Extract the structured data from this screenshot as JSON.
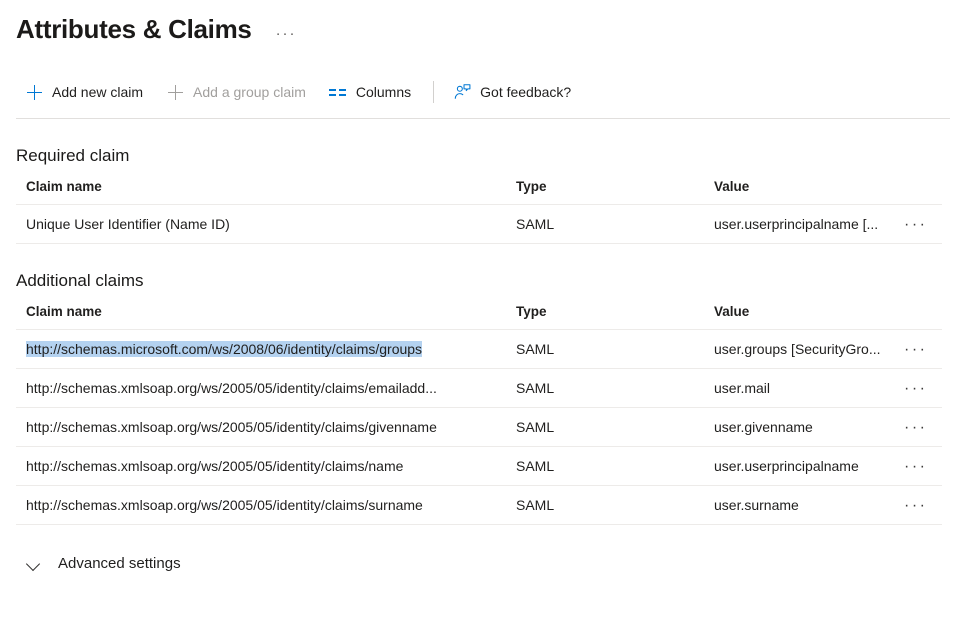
{
  "header": {
    "title": "Attributes & Claims",
    "more_menu": "···"
  },
  "toolbar": {
    "add_new_claim": "Add new claim",
    "add_group_claim": "Add a group claim",
    "columns": "Columns",
    "got_feedback": "Got feedback?"
  },
  "required_claim": {
    "section_title": "Required claim",
    "columns": {
      "name": "Claim name",
      "type": "Type",
      "value": "Value"
    },
    "rows": [
      {
        "name": "Unique User Identifier (Name ID)",
        "type": "SAML",
        "value": "user.userprincipalname [...",
        "menu": "···"
      }
    ]
  },
  "additional_claims": {
    "section_title": "Additional claims",
    "columns": {
      "name": "Claim name",
      "type": "Type",
      "value": "Value"
    },
    "rows": [
      {
        "name": "http://schemas.microsoft.com/ws/2008/06/identity/claims/groups",
        "type": "SAML",
        "value": "user.groups [SecurityGro...",
        "menu": "···",
        "selected": true
      },
      {
        "name": "http://schemas.xmlsoap.org/ws/2005/05/identity/claims/emailadd...",
        "type": "SAML",
        "value": "user.mail",
        "menu": "···",
        "selected": false
      },
      {
        "name": "http://schemas.xmlsoap.org/ws/2005/05/identity/claims/givenname",
        "type": "SAML",
        "value": "user.givenname",
        "menu": "···",
        "selected": false
      },
      {
        "name": "http://schemas.xmlsoap.org/ws/2005/05/identity/claims/name",
        "type": "SAML",
        "value": "user.userprincipalname",
        "menu": "···",
        "selected": false
      },
      {
        "name": "http://schemas.xmlsoap.org/ws/2005/05/identity/claims/surname",
        "type": "SAML",
        "value": "user.surname",
        "menu": "···",
        "selected": false
      }
    ]
  },
  "footer": {
    "advanced_settings": "Advanced settings"
  },
  "icons": {
    "add_plus": "plus-icon",
    "columns": "columns-icon",
    "feedback": "person-feedback-icon",
    "chevron": "chevron-down-icon"
  },
  "colors": {
    "accent": "#0078d4",
    "disabled_text": "#a19f9d",
    "selection": "#b4d2f0",
    "divider": "#e1dfdd",
    "row_divider": "#edebe9"
  }
}
